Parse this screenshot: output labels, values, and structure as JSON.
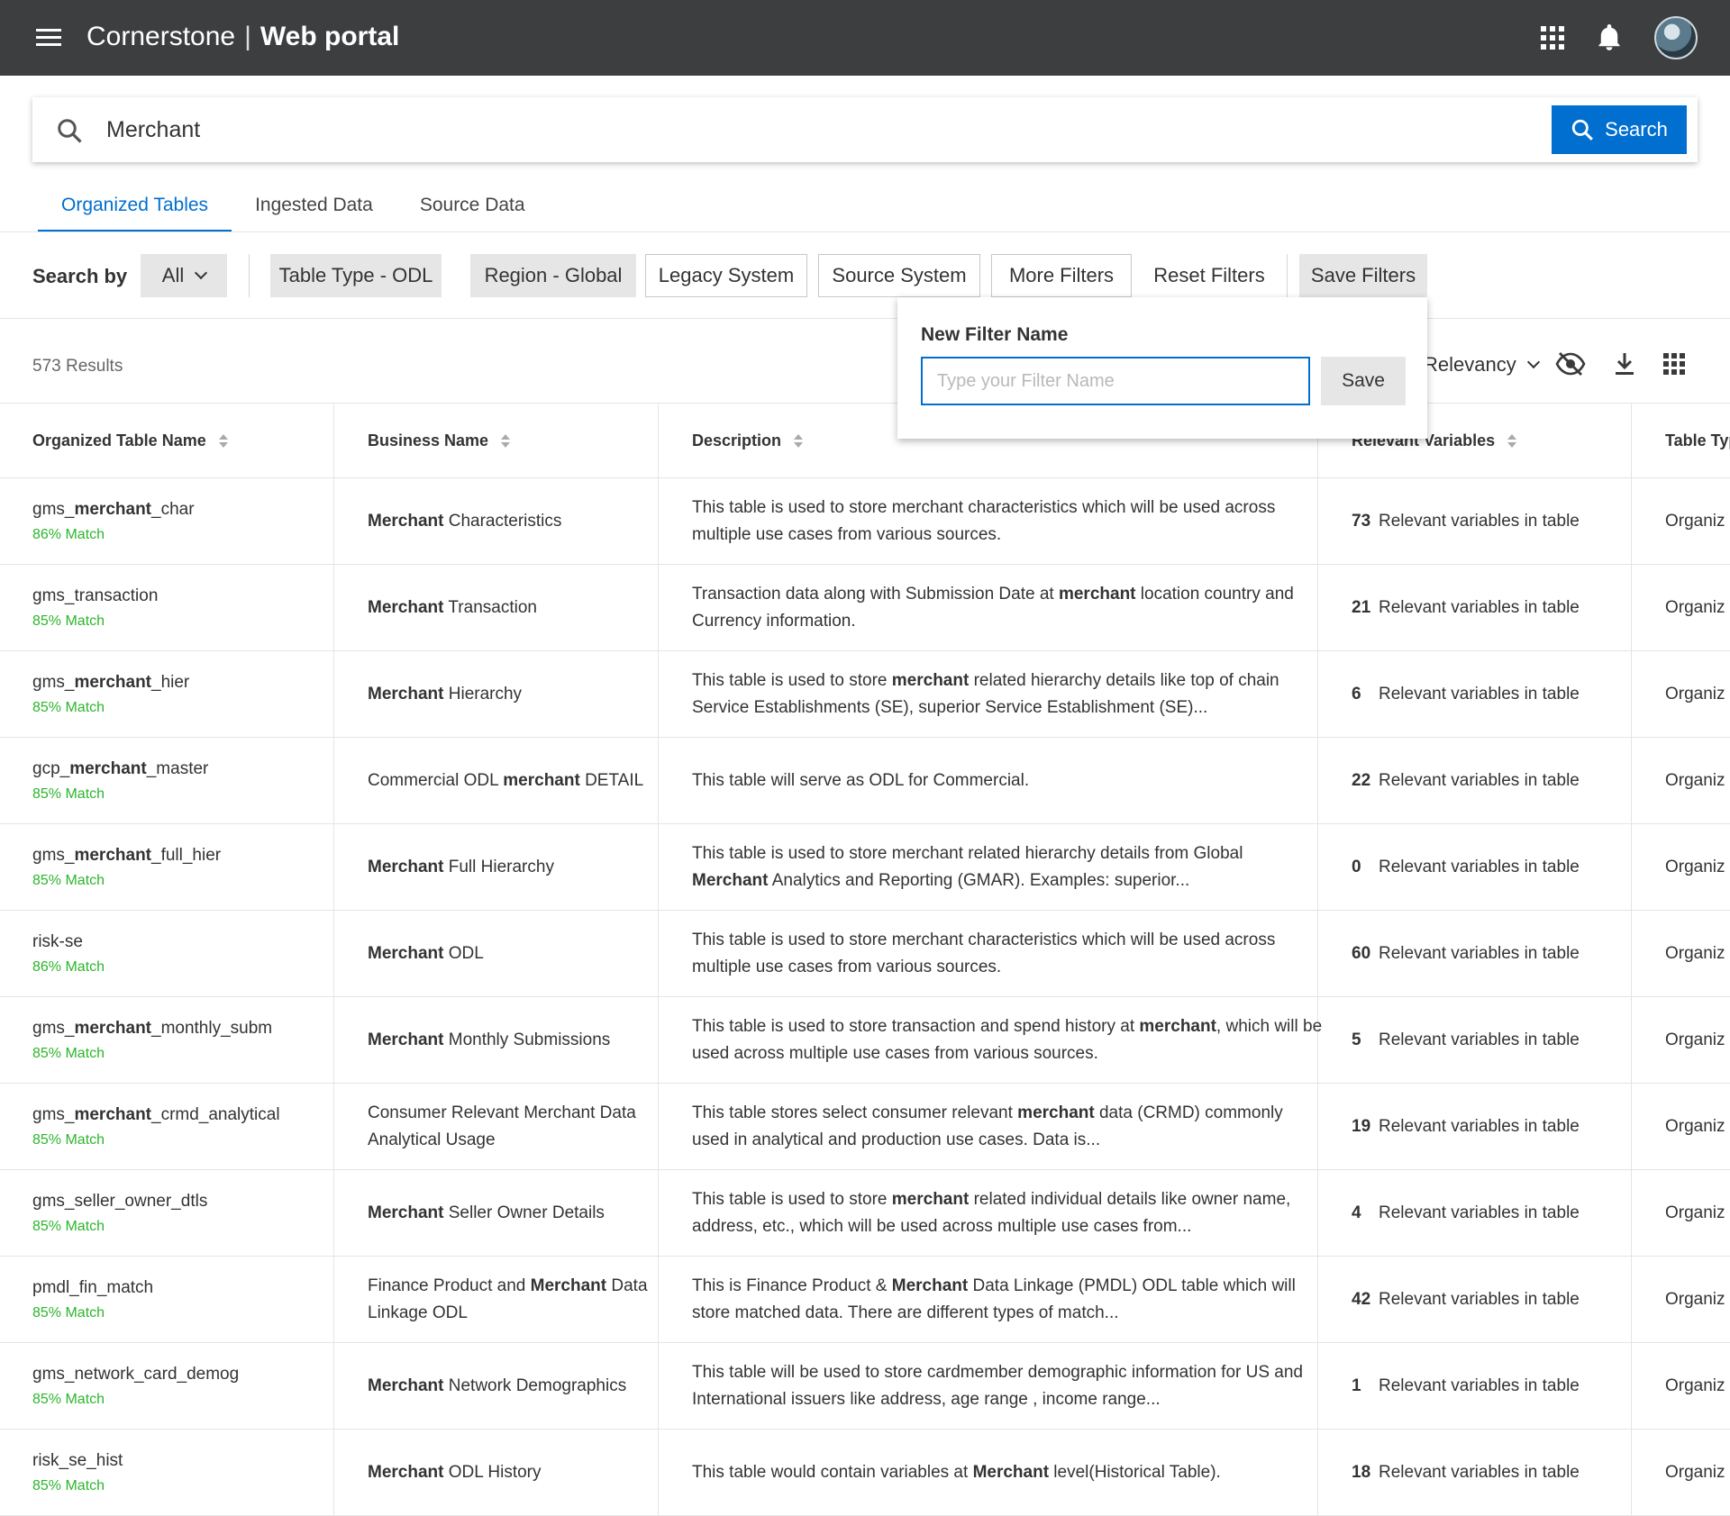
{
  "header": {
    "brand": "Cornerstone",
    "product": "Web portal"
  },
  "search": {
    "value": "Merchant",
    "button_label": "Search"
  },
  "tabs": [
    "Organized Tables",
    "Ingested Data",
    "Source Data"
  ],
  "filters": {
    "search_by_label": "Search by",
    "all_label": "All",
    "chips": [
      "Table Type - ODL",
      "Region - Global",
      "Legacy System",
      "Source System",
      "More Filters",
      "Reset Filters",
      "Save Filters"
    ]
  },
  "results": {
    "count_label": "573 Results",
    "sort_label": "Relevancy"
  },
  "popover": {
    "title": "New Filter Name",
    "placeholder": "Type your Filter Name",
    "save_label": "Save"
  },
  "table": {
    "columns": [
      "Organized Table Name",
      "Business Name",
      "Description",
      "Relevant Variables",
      "Table Type"
    ],
    "variables_suffix": "Relevant variables in table",
    "type_value": "Organiz",
    "rows": [
      {
        "name_pre": "gms_",
        "name_bold": "merchant",
        "name_post": "_char",
        "match": "86% Match",
        "biz_bold": "Merchant",
        "biz_rest": " Characteristics",
        "desc_pre": "This table is used to store merchant characteristics which will be used across multiple use cases from various sources.",
        "desc_bold": "",
        "desc_post": "",
        "vars": "73"
      },
      {
        "name_pre": "gms_transaction",
        "name_bold": "",
        "name_post": "",
        "match": "85% Match",
        "biz_bold": "Merchant",
        "biz_rest": " Transaction",
        "desc_pre": "Transaction data along with Submission Date at ",
        "desc_bold": "merchant",
        "desc_post": " location country and Currency information.",
        "vars": "21"
      },
      {
        "name_pre": "gms_",
        "name_bold": "merchant",
        "name_post": "_hier",
        "match": "85% Match",
        "biz_bold": "Merchant",
        "biz_rest": " Hierarchy",
        "desc_pre": "This table is used to store ",
        "desc_bold": "merchant",
        "desc_post": " related hierarchy details like top of chain Service Establishments (SE), superior Service Establishment (SE)...",
        "vars": "6"
      },
      {
        "name_pre": "gcp_",
        "name_bold": "merchant",
        "name_post": "_master",
        "match": "85% Match",
        "biz_pre": "Commercial ODL ",
        "biz_bold": "merchant",
        "biz_rest": " DETAIL",
        "desc_pre": "This table will serve as ODL for Commercial.",
        "desc_bold": "",
        "desc_post": "",
        "vars": "22"
      },
      {
        "name_pre": "gms_",
        "name_bold": "merchant",
        "name_post": "_full_hier",
        "match": "85% Match",
        "biz_bold": "Merchant",
        "biz_rest": " Full Hierarchy",
        "desc_pre": "This table is used to store merchant related hierarchy details from Global ",
        "desc_bold": "Merchant",
        "desc_post": " Analytics and Reporting (GMAR). Examples: superior...",
        "vars": "0"
      },
      {
        "name_pre": "risk-se",
        "name_bold": "",
        "name_post": "",
        "match": "86% Match",
        "biz_bold": "Merchant",
        "biz_rest": " ODL",
        "desc_pre": "This table is used to store merchant characteristics which will be used across multiple use cases from various sources.",
        "desc_bold": "",
        "desc_post": "",
        "vars": "60"
      },
      {
        "name_pre": "gms_",
        "name_bold": "merchant",
        "name_post": "_monthly_subm",
        "match": "85% Match",
        "biz_bold": "Merchant",
        "biz_rest": " Monthly Submissions",
        "desc_pre": "This table is used to store transaction and spend history at ",
        "desc_bold": "merchant",
        "desc_post": ", which will be used across multiple use cases from various sources.",
        "vars": "5"
      },
      {
        "name_pre": "gms_",
        "name_bold": "merchant",
        "name_post": "_crmd_analytical",
        "match": "85% Match",
        "biz_pre": "Consumer Relevant Merchant Data Analytical Usage",
        "biz_bold": "",
        "biz_rest": "",
        "desc_pre": "This table stores select consumer relevant ",
        "desc_bold": "merchant",
        "desc_post": " data (CRMD) commonly used in analytical and production use cases. Data is...",
        "vars": "19"
      },
      {
        "name_pre": "gms_seller_owner_dtls",
        "name_bold": "",
        "name_post": "",
        "match": "85% Match",
        "biz_bold": "Merchant",
        "biz_rest": " Seller Owner Details",
        "desc_pre": "This table is used to store ",
        "desc_bold": "merchant",
        "desc_post": " related individual details like owner name, address, etc.,  which will be used across multiple use cases from...",
        "vars": "4"
      },
      {
        "name_pre": "pmdl_fin_match",
        "name_bold": "",
        "name_post": "",
        "match": "85% Match",
        "biz_pre": "Finance Product and ",
        "biz_bold": "Merchant",
        "biz_rest": " Data Linkage ODL",
        "desc_pre": "This is Finance Product & ",
        "desc_bold": "Merchant",
        "desc_post": " Data Linkage (PMDL) ODL table which will store matched data. There are different types of match...",
        "vars": "42"
      },
      {
        "name_pre": "gms_network_card_demog",
        "name_bold": "",
        "name_post": "",
        "match": "85% Match",
        "biz_bold": "Merchant",
        "biz_rest": " Network Demographics",
        "desc_pre": "This table will be used to store cardmember demographic information for US and International issuers like address, age range , income range...",
        "desc_bold": "",
        "desc_post": "",
        "vars": "1"
      },
      {
        "name_pre": "risk_se_hist",
        "name_bold": "",
        "name_post": "",
        "match": "85% Match",
        "biz_bold": "Merchant",
        "biz_rest": " ODL History",
        "desc_pre": "This table would contain variables at ",
        "desc_bold": "Merchant",
        "desc_post": " level(Historical Table).",
        "vars": "18"
      }
    ]
  },
  "colors": {
    "topbar": "#3d3e40",
    "accent": "#006fcf",
    "match_green": "#2db52d"
  }
}
